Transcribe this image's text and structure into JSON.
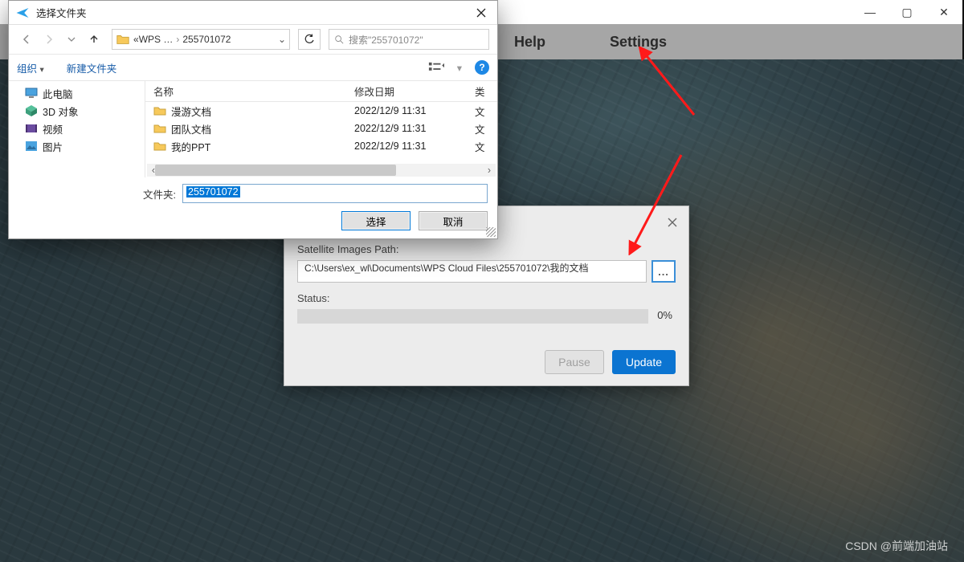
{
  "app": {
    "menu": {
      "help": "Help",
      "settings": "Settings"
    },
    "window_controls": {
      "min": "—",
      "max": "▢",
      "close": "✕"
    }
  },
  "settings_dialog": {
    "path_label": "Satellite Images Path:",
    "path_value": "C:\\Users\\ex_wl\\Documents\\WPS Cloud Files\\255701072\\我的文档",
    "browse": "...",
    "status_label": "Status:",
    "progress_pct": "0%",
    "pause": "Pause",
    "update": "Update"
  },
  "file_dialog": {
    "title": "选择文件夹",
    "breadcrumb": {
      "root": "WPS …",
      "current": "255701072"
    },
    "search_placeholder": "搜索\"255701072\"",
    "toolbar": {
      "organize": "组织",
      "new_folder": "新建文件夹"
    },
    "tree": [
      {
        "icon": "pc",
        "label": "此电脑"
      },
      {
        "icon": "cube",
        "label": "3D 对象"
      },
      {
        "icon": "video",
        "label": "视频"
      },
      {
        "icon": "picture",
        "label": "图片"
      }
    ],
    "columns": {
      "name": "名称",
      "date": "修改日期",
      "type": "类"
    },
    "rows": [
      {
        "name": "漫游文档",
        "date": "2022/12/9 11:31",
        "type": "文"
      },
      {
        "name": "团队文档",
        "date": "2022/12/9 11:31",
        "type": "文"
      },
      {
        "name": "我的PPT",
        "date": "2022/12/9 11:31",
        "type": "文"
      }
    ],
    "folder_label": "文件夹:",
    "folder_value": "255701072",
    "select_btn": "选择",
    "cancel_btn": "取消"
  },
  "watermark": "CSDN @前端加油站"
}
